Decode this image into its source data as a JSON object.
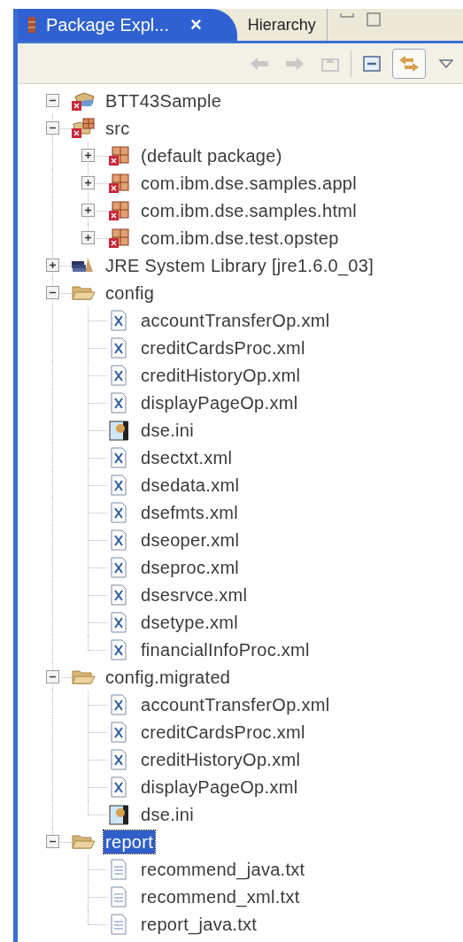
{
  "tabs": [
    {
      "label": "Package Expl...",
      "selected": true,
      "close": "×"
    },
    {
      "label": "Hierarchy",
      "selected": false
    }
  ],
  "toolbar": [
    {
      "kind": "back",
      "disabled": true,
      "pressed": false
    },
    {
      "kind": "forward",
      "disabled": true,
      "pressed": false
    },
    {
      "kind": "up",
      "disabled": true,
      "pressed": false
    },
    {
      "kind": "collapse",
      "disabled": false,
      "pressed": false
    },
    {
      "kind": "link",
      "disabled": false,
      "pressed": true
    },
    {
      "kind": "menu",
      "disabled": false,
      "pressed": false
    }
  ],
  "tree": [
    {
      "label": "BTT43Sample",
      "kind": "project",
      "expanded": true,
      "selected": false,
      "children": [
        {
          "label": "src",
          "kind": "source",
          "expanded": true,
          "selected": false,
          "children": [
            {
              "label": "(default package)",
              "kind": "package",
              "expanded": false,
              "selected": false
            },
            {
              "label": "com.ibm.dse.samples.appl",
              "kind": "package",
              "expanded": false,
              "selected": false
            },
            {
              "label": "com.ibm.dse.samples.html",
              "kind": "package",
              "expanded": false,
              "selected": false
            },
            {
              "label": "com.ibm.dse.test.opstep",
              "kind": "package",
              "expanded": false,
              "selected": false
            }
          ]
        },
        {
          "label": "JRE System Library [jre1.6.0_03]",
          "kind": "library",
          "expanded": false,
          "selected": false
        },
        {
          "label": "config",
          "kind": "folder",
          "expanded": true,
          "selected": false,
          "children": [
            {
              "label": "accountTransferOp.xml",
              "kind": "xml",
              "selected": false
            },
            {
              "label": "creditCardsProc.xml",
              "kind": "xml",
              "selected": false
            },
            {
              "label": "creditHistoryOp.xml",
              "kind": "xml",
              "selected": false
            },
            {
              "label": "displayPageOp.xml",
              "kind": "xml",
              "selected": false
            },
            {
              "label": "dse.ini",
              "kind": "ini",
              "selected": false
            },
            {
              "label": "dsectxt.xml",
              "kind": "xml",
              "selected": false
            },
            {
              "label": "dsedata.xml",
              "kind": "xml",
              "selected": false
            },
            {
              "label": "dsefmts.xml",
              "kind": "xml",
              "selected": false
            },
            {
              "label": "dseoper.xml",
              "kind": "xml",
              "selected": false
            },
            {
              "label": "dseproc.xml",
              "kind": "xml",
              "selected": false
            },
            {
              "label": "dsesrvce.xml",
              "kind": "xml",
              "selected": false
            },
            {
              "label": "dsetype.xml",
              "kind": "xml",
              "selected": false
            },
            {
              "label": "financialInfoProc.xml",
              "kind": "xml",
              "selected": false
            }
          ]
        },
        {
          "label": "config.migrated",
          "kind": "folder",
          "expanded": true,
          "selected": false,
          "children": [
            {
              "label": "accountTransferOp.xml",
              "kind": "xml",
              "selected": false
            },
            {
              "label": "creditCardsProc.xml",
              "kind": "xml",
              "selected": false
            },
            {
              "label": "creditHistoryOp.xml",
              "kind": "xml",
              "selected": false
            },
            {
              "label": "displayPageOp.xml",
              "kind": "xml",
              "selected": false
            },
            {
              "label": "dse.ini",
              "kind": "ini",
              "selected": false
            }
          ]
        },
        {
          "label": "report",
          "kind": "folder",
          "expanded": true,
          "selected": true,
          "children": [
            {
              "label": "recommend_java.txt",
              "kind": "txt",
              "selected": false
            },
            {
              "label": "recommend_xml.txt",
              "kind": "txt",
              "selected": false
            },
            {
              "label": "report_java.txt",
              "kind": "txt",
              "selected": false
            }
          ]
        }
      ]
    }
  ]
}
